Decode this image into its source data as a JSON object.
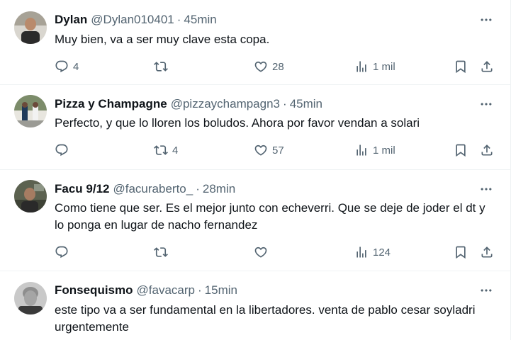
{
  "tweets": [
    {
      "name": "Dylan",
      "handle": "@Dylan010401",
      "time": "45min",
      "text": "Muy bien, va a ser muy clave esta copa.",
      "replies": "4",
      "retweets": "",
      "likes": "28",
      "views": "1 mil"
    },
    {
      "name": "Pizza y Champagne",
      "handle": "@pizzaychampagn3",
      "time": "45min",
      "text": "Perfecto, y que lo lloren los boludos. Ahora por favor vendan a solari",
      "replies": "",
      "retweets": "4",
      "likes": "57",
      "views": "1 mil"
    },
    {
      "name": "Facu 9/12",
      "handle": "@facuraberto_",
      "time": "28min",
      "text": "Como tiene que ser. Es el mejor junto con echeverri. Que se deje de joder el dt y lo ponga en lugar de nacho fernandez",
      "replies": "",
      "retweets": "",
      "likes": "",
      "views": "124"
    },
    {
      "name": "Fonsequismo",
      "handle": "@favacarp",
      "time": "15min",
      "text": "este tipo va a ser fundamental en la libertadores. venta de pablo cesar soyladri urgentemente"
    }
  ],
  "separator": "·",
  "icons": {
    "reply": "reply-icon",
    "retweet": "retweet-icon",
    "like": "heart-icon",
    "views": "views-icon",
    "bookmark": "bookmark-icon",
    "share": "share-icon",
    "more": "more-icon"
  },
  "colors": {
    "text": "#0f1419",
    "secondary": "#536471",
    "border": "#eff3f4"
  }
}
